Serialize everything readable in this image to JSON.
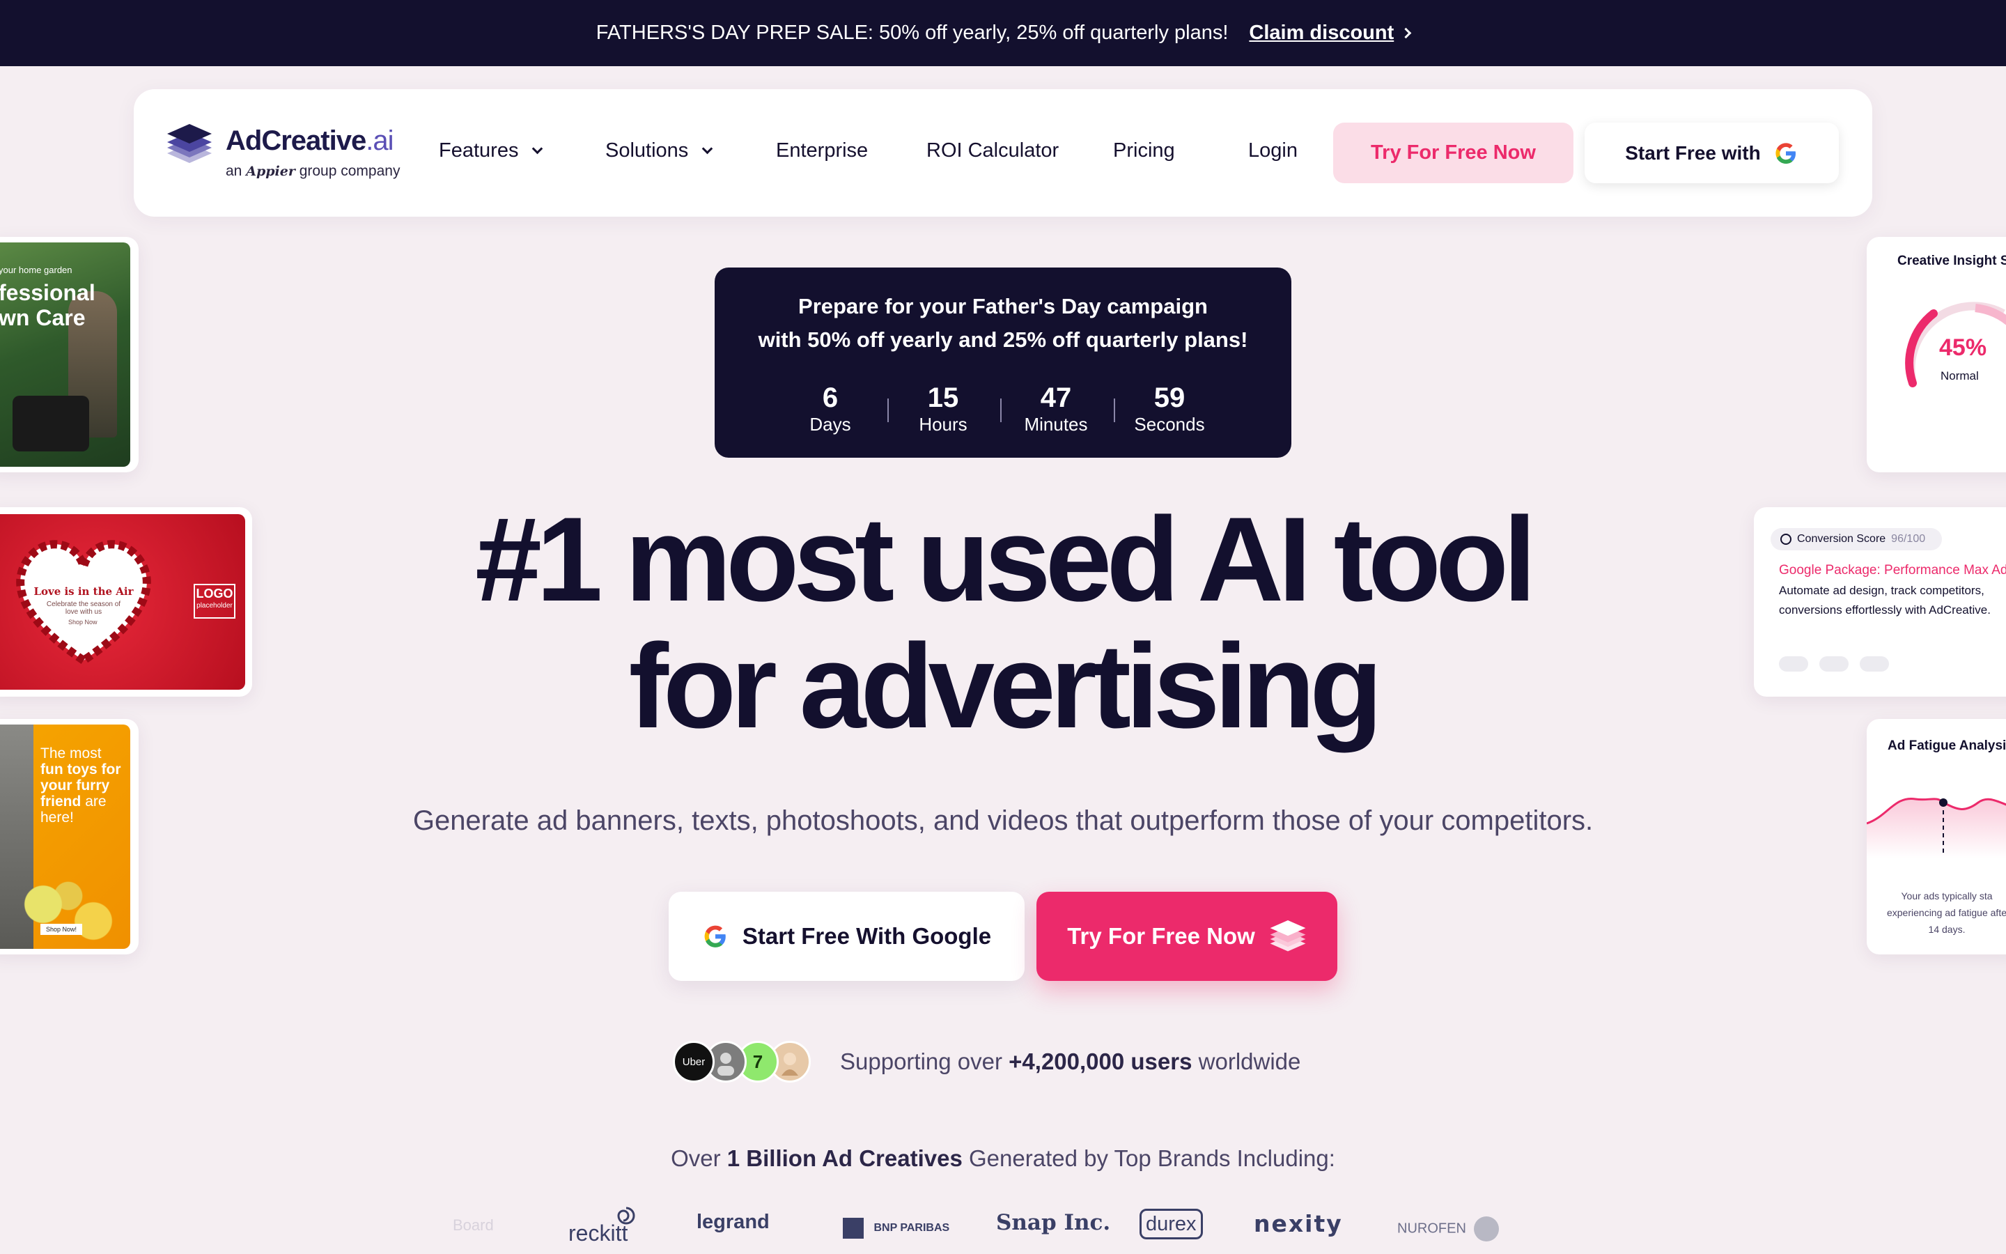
{
  "banner": {
    "text": "FATHERS'S DAY PREP SALE: 50% off yearly, 25% off quarterly plans!",
    "link": "Claim discount"
  },
  "logo": {
    "name": "AdCreative",
    "suffix": ".ai",
    "sub_prefix": "an",
    "sub_brand": "Appier",
    "sub_suffix": "group company"
  },
  "nav": {
    "features": "Features",
    "solutions": "Solutions",
    "enterprise": "Enterprise",
    "roi": "ROI Calculator",
    "pricing": "Pricing",
    "login": "Login",
    "try": "Try For Free Now",
    "google": "Start Free with"
  },
  "promo": {
    "line1": "Prepare for your Father's Day campaign",
    "line2": "with 50% off yearly and 25% off quarterly plans!",
    "countdown": [
      {
        "value": "6",
        "label": "Days"
      },
      {
        "value": "15",
        "label": "Hours"
      },
      {
        "value": "47",
        "label": "Minutes"
      },
      {
        "value": "59",
        "label": "Seconds"
      }
    ]
  },
  "hero": {
    "line1": "#1 most used AI tool",
    "line2": "for advertising",
    "subtitle": "Generate ad banners, texts, photoshoots, and videos that outperform those of your competitors.",
    "cta_google": "Start Free With Google",
    "cta_try": "Try For Free Now"
  },
  "social": {
    "avatar_uber": "Uber",
    "text_prefix": "Supporting over",
    "users": "+4,200,000 users",
    "text_suffix": "worldwide"
  },
  "brands": {
    "prefix": "Over",
    "highlight": "1 Billion Ad Creatives",
    "suffix": "Generated by Top Brands Including:",
    "list": [
      "Board",
      "reckitt",
      "legrand",
      "BNP PARIBAS",
      "Snap Inc.",
      "durex",
      "nexity",
      "NUROFEN"
    ]
  },
  "left_cards": {
    "lawn_small": "your home garden",
    "lawn_big1": "fessional",
    "lawn_big2": "wn Care",
    "love_title": "Love is in the Air",
    "love_sub": "Celebrate the season of love with us",
    "love_btn": "Shop Now",
    "logo_ph": "LOGO",
    "logo_ph_sub": "placeholder",
    "toys_l1": "The most",
    "toys_l2": "fun toys for",
    "toys_l3": "your furry",
    "toys_l4": "friend",
    "toys_l4b": "are",
    "toys_l5": "here!",
    "toys_btn": "Shop Now!"
  },
  "right_cards": {
    "insight_title": "Creative Insight Sc",
    "insight_value": "45%",
    "insight_label": "Normal",
    "conv_badge": "Conversion Score",
    "conv_score": "96/100",
    "conv_title": "Google Package: Performance Max Ad",
    "conv_line1": "Automate ad design, track competitors,",
    "conv_line2": "conversions effortlessly with AdCreative.",
    "fatigue_title": "Ad Fatigue Analysis",
    "fatigue_l1": "Your ads typically sta",
    "fatigue_l2": "experiencing ad fatigue afte",
    "fatigue_l3": "14 days."
  },
  "colors": {
    "dark": "#13102e",
    "pink": "#ec2a6b",
    "pink_light": "#fbdde7",
    "bg": "#f5eef2"
  }
}
